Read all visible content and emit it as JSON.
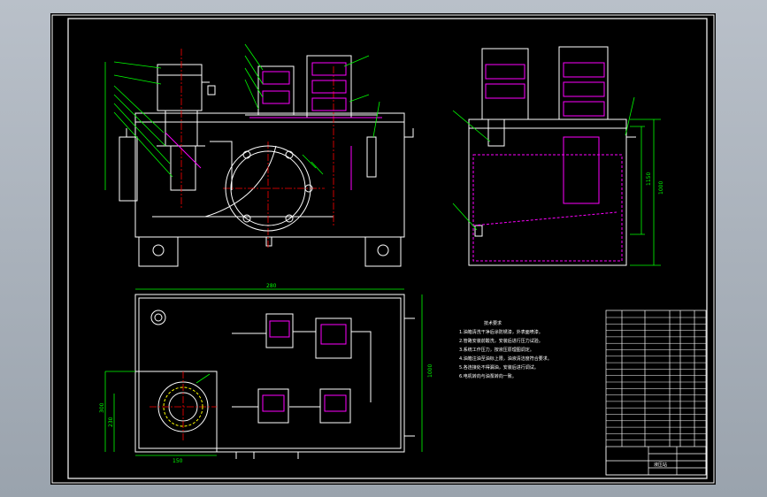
{
  "drawing": {
    "dims": {
      "top_width": "280",
      "right_height_a": "1000",
      "right_height_b": "1150",
      "plan_right": "1000",
      "plan_left_a": "300",
      "plan_left_b": "230",
      "plan_bottom": "150"
    },
    "notes": {
      "title": "技术要求",
      "lines": [
        "1.油箱清洗干净后涂防锈漆，外表面喷漆。",
        "2.管路安装前酸洗，安装后进行压力试验。",
        "3.系统工作压力，按液压原理图调定。",
        "4.油箱注油至油标上限，油液清洁度符合要求。",
        "5.各连接处不得漏油，安装后进行调试。",
        "6.电机转向与油泵转向一致。"
      ]
    },
    "title_block": {
      "corner_label": "液压站"
    }
  },
  "colors": {
    "background": "#000000",
    "outline": "#ffffff",
    "dimension": "#00ff00",
    "center": "#ff0000",
    "hidden": "#ff00ff",
    "accent": "#ffff00"
  }
}
